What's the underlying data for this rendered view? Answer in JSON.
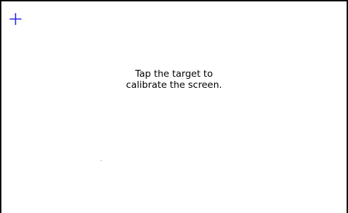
{
  "calibration": {
    "instruction_line_1": "Tap the target to",
    "instruction_line_2": "calibrate the screen.",
    "target_icon": "crosshair-plus-icon",
    "target_color": "#2020e0"
  }
}
